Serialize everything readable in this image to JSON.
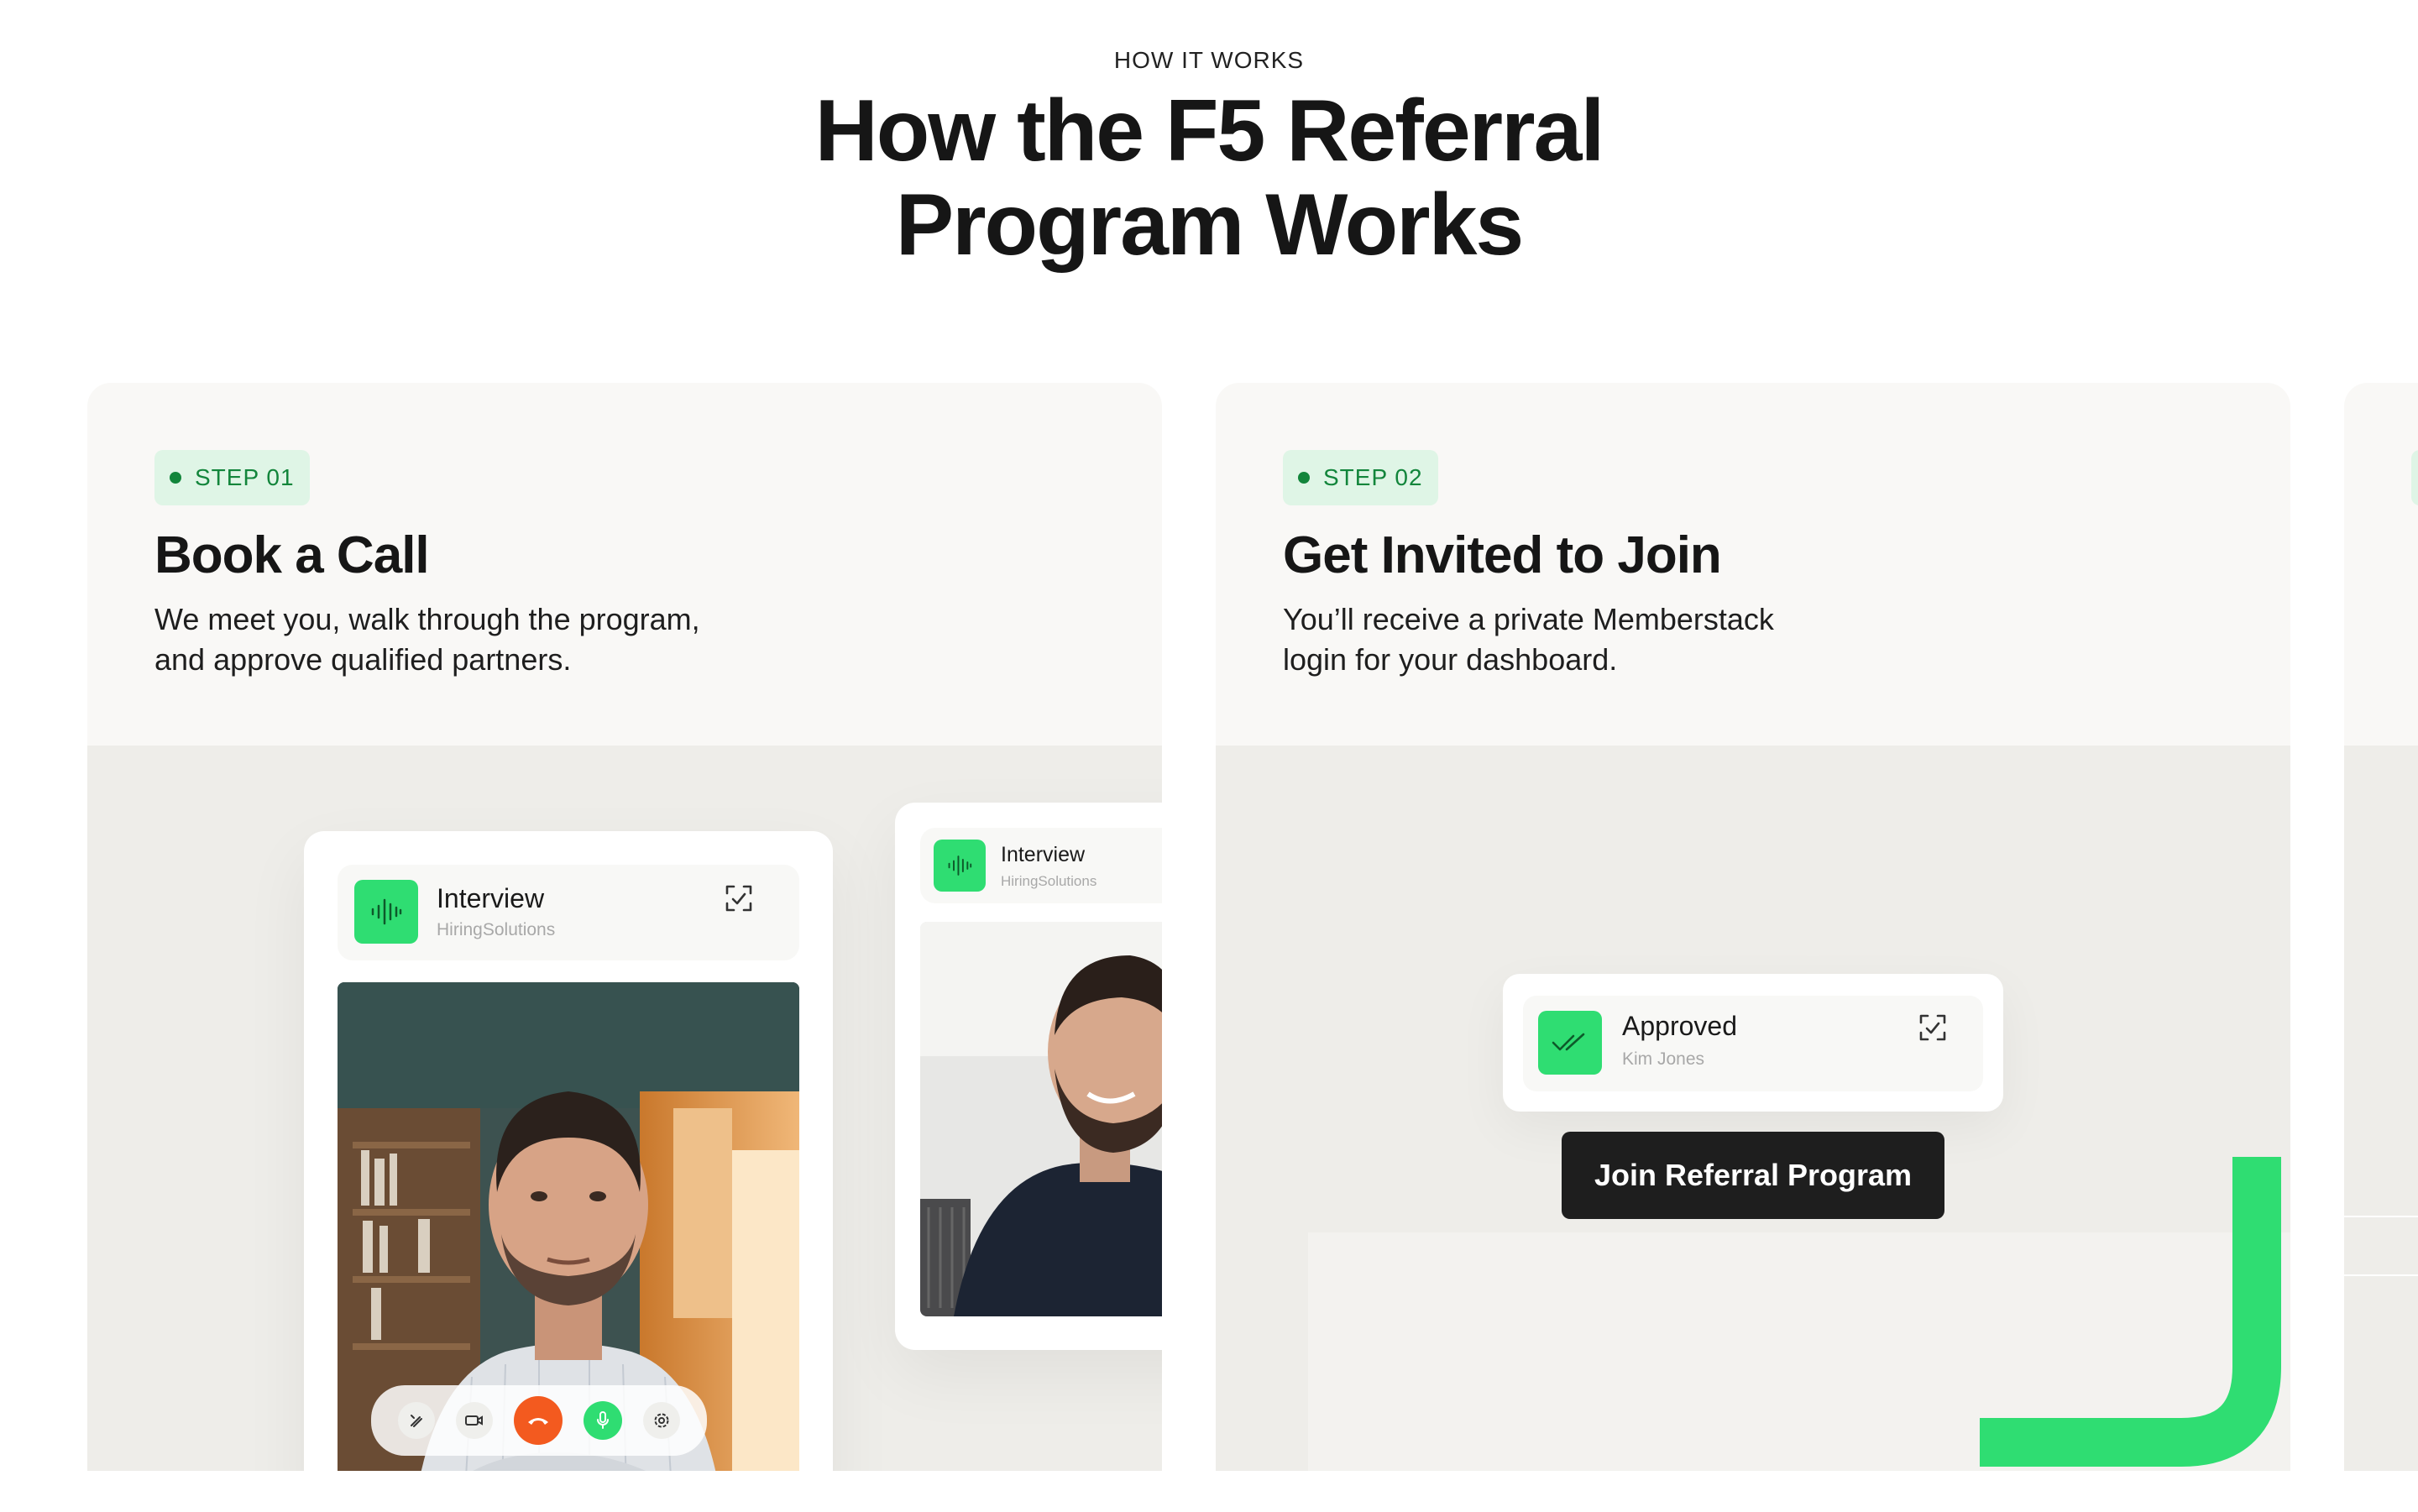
{
  "section": {
    "eyebrow": "HOW IT WORKS",
    "heading_line1": "How the F5 Referral",
    "heading_line2": "Program Works"
  },
  "steps": [
    {
      "badge": "STEP 01",
      "title": "Book a Call",
      "desc_line1": "We meet you, walk through the program,",
      "desc_line2": "and approve qualified partners.",
      "call_main": {
        "title": "Interview",
        "subtitle": "HiringSolutions"
      },
      "call_side": {
        "title": "Interview",
        "subtitle": "HiringSolutions"
      },
      "controls": [
        "magic-wand-icon",
        "camera-icon",
        "end-call-icon",
        "mic-icon",
        "settings-icon"
      ]
    },
    {
      "badge": "STEP 02",
      "title": "Get Invited to Join",
      "desc_line1": "You’ll receive a private Memberstack",
      "desc_line2": "login for your dashboard.",
      "status": {
        "title": "Approved",
        "subtitle": "Kim Jones"
      },
      "button": "Join Referral Program"
    }
  ],
  "colors": {
    "accent_green": "#2fdd72",
    "badge_green_bg": "#dff5e6",
    "badge_green_text": "#12853b",
    "end_call": "#f35a1f"
  }
}
